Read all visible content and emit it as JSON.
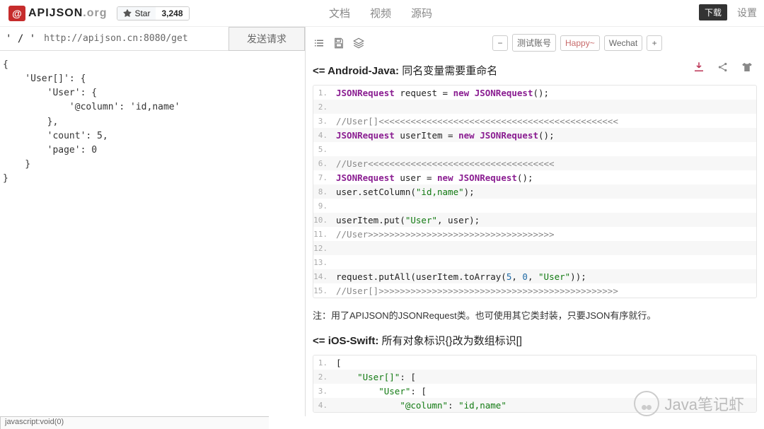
{
  "header": {
    "logo_at": "@",
    "logo_text": "APIJSON",
    "logo_suffix": ".org",
    "star_label": "Star",
    "star_count": "3,248",
    "nav": {
      "docs": "文档",
      "video": "视频",
      "source": "源码"
    },
    "download": "下载",
    "settings": "设置"
  },
  "left": {
    "quote": "' / '",
    "url": "http://apijson.cn:8080/get",
    "send": "发送请求",
    "editor": "{\n    'User[]': {\n        'User': {\n            '@column': 'id,name'\n        },\n        'count': 5,\n        'page': 0\n    }\n}"
  },
  "right": {
    "tabs": {
      "minus": "−",
      "test_account": "测试账号",
      "happy": "Happy~",
      "wechat": "Wechat",
      "plus": "+"
    },
    "section1": {
      "arrow": "<=",
      "title": "Android-Java:",
      "subtitle": "同名变量需要重命名"
    },
    "code1": [
      {
        "n": "1.",
        "html": "<span class='k'>JSONRequest</span> request = <span class='k'>new</span> <span class='k'>JSONRequest</span>();"
      },
      {
        "n": "2.",
        "html": ""
      },
      {
        "n": "3.",
        "html": "<span class='c'>//User[]&lt;&lt;&lt;&lt;&lt;&lt;&lt;&lt;&lt;&lt;&lt;&lt;&lt;&lt;&lt;&lt;&lt;&lt;&lt;&lt;&lt;&lt;&lt;&lt;&lt;&lt;&lt;&lt;&lt;&lt;&lt;&lt;&lt;&lt;&lt;&lt;&lt;&lt;&lt;&lt;&lt;&lt;&lt;&lt;&lt;</span>"
      },
      {
        "n": "4.",
        "html": "<span class='k'>JSONRequest</span> userItem = <span class='k'>new</span> <span class='k'>JSONRequest</span>();"
      },
      {
        "n": "5.",
        "html": ""
      },
      {
        "n": "6.",
        "html": "<span class='c'>//User&lt;&lt;&lt;&lt;&lt;&lt;&lt;&lt;&lt;&lt;&lt;&lt;&lt;&lt;&lt;&lt;&lt;&lt;&lt;&lt;&lt;&lt;&lt;&lt;&lt;&lt;&lt;&lt;&lt;&lt;&lt;&lt;&lt;&lt;&lt;</span>"
      },
      {
        "n": "7.",
        "html": "<span class='k'>JSONRequest</span> user = <span class='k'>new</span> <span class='k'>JSONRequest</span>();"
      },
      {
        "n": "8.",
        "html": "user.setColumn(<span class='s'>\"id,name\"</span>);"
      },
      {
        "n": "9.",
        "html": ""
      },
      {
        "n": "10.",
        "html": "userItem.put(<span class='s'>\"User\"</span>, user);"
      },
      {
        "n": "11.",
        "html": "<span class='c'>//User&gt;&gt;&gt;&gt;&gt;&gt;&gt;&gt;&gt;&gt;&gt;&gt;&gt;&gt;&gt;&gt;&gt;&gt;&gt;&gt;&gt;&gt;&gt;&gt;&gt;&gt;&gt;&gt;&gt;&gt;&gt;&gt;&gt;&gt;&gt;</span>"
      },
      {
        "n": "12.",
        "html": ""
      },
      {
        "n": "13.",
        "html": ""
      },
      {
        "n": "14.",
        "html": "request.putAll(userItem.toArray(<span class='n'>5</span>, <span class='n'>0</span>, <span class='s'>\"User\"</span>));"
      },
      {
        "n": "15.",
        "html": "<span class='c'>//User[]&gt;&gt;&gt;&gt;&gt;&gt;&gt;&gt;&gt;&gt;&gt;&gt;&gt;&gt;&gt;&gt;&gt;&gt;&gt;&gt;&gt;&gt;&gt;&gt;&gt;&gt;&gt;&gt;&gt;&gt;&gt;&gt;&gt;&gt;&gt;&gt;&gt;&gt;&gt;&gt;&gt;&gt;&gt;&gt;&gt;</span>"
      }
    ],
    "note": "注：用了APIJSON的JSONRequest类。也可使用其它类封装，只要JSON有序就行。",
    "section2": {
      "arrow": "<=",
      "title": "iOS-Swift:",
      "subtitle": "所有对象标识{}改为数组标识[]"
    },
    "code2": [
      {
        "n": "1.",
        "html": "["
      },
      {
        "n": "2.",
        "html": "    <span class='s'>\"User[]\"</span>: ["
      },
      {
        "n": "3.",
        "html": "        <span class='s'>\"User\"</span>: ["
      },
      {
        "n": "4.",
        "html": "            <span class='s'>\"@column\"</span>: <span class='s'>\"id,name\"</span>"
      }
    ]
  },
  "status": "javascript:void(0)",
  "watermark": "Java笔记虾"
}
